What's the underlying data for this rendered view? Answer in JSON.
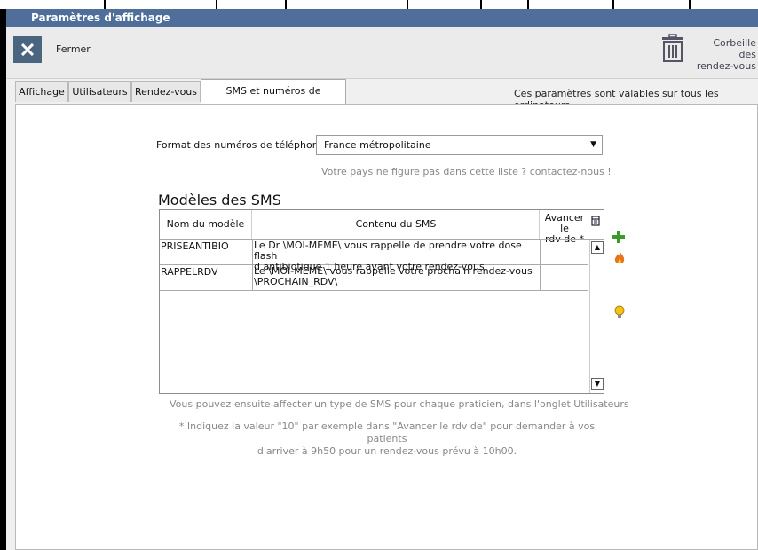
{
  "window": {
    "title": "Paramètres d'affichage"
  },
  "toolbar": {
    "close_label": "Fermer",
    "trash_line1": "Corbeille des",
    "trash_line2": "rendez-vous"
  },
  "tabs": [
    {
      "label": "Affichage"
    },
    {
      "label": "Utilisateurs"
    },
    {
      "label": "Rendez-vous"
    },
    {
      "label": "SMS et numéros de téléphones",
      "active": true
    }
  ],
  "tabs_note": "Ces paramètres sont valables sur tous les ordinateurs",
  "phone_format": {
    "label": "Format des numéros de téléphone",
    "value": "France métropolitaine",
    "note": "Votre pays ne figure pas dans cette liste ? contactez-nous !"
  },
  "models": {
    "title": "Modèles des SMS",
    "headers": {
      "name": "Nom du modèle",
      "content": "Contenu du SMS",
      "advance_line1": "Avancer le",
      "advance_line2": "rdv de *"
    },
    "rows": [
      {
        "name": "PRISEANTIBIO",
        "content_line1": "Le Dr \\MOI-MEME\\ vous rappelle de prendre votre dose flash",
        "content_line2": "d antibiotique 1 heure avant votre rendez-vous",
        "advance": ""
      },
      {
        "name": "RAPPELRDV",
        "content_line1": "Le \\MOI-MEME\\ vous rappelle votre prochain rendez-vous",
        "content_line2": "\\PROCHAIN_RDV\\",
        "advance": ""
      }
    ]
  },
  "notes": {
    "assign": "Vous pouvez ensuite affecter un type de SMS pour chaque praticien, dans l'onglet Utilisateurs",
    "hint_line1": "* Indiquez la valeur \"10\" par exemple dans \"Avancer le rdv de\" pour demander à vos patients",
    "hint_line2": "d'arriver à 9h50 pour un rendez-vous prévu à 10h00."
  },
  "colors": {
    "titlebar": "#4f6f9a",
    "close_button": "#4a6580",
    "add_icon": "#3a9a2a",
    "fire_icon": "#e8731a",
    "bulb_icon": "#f2c21a"
  }
}
